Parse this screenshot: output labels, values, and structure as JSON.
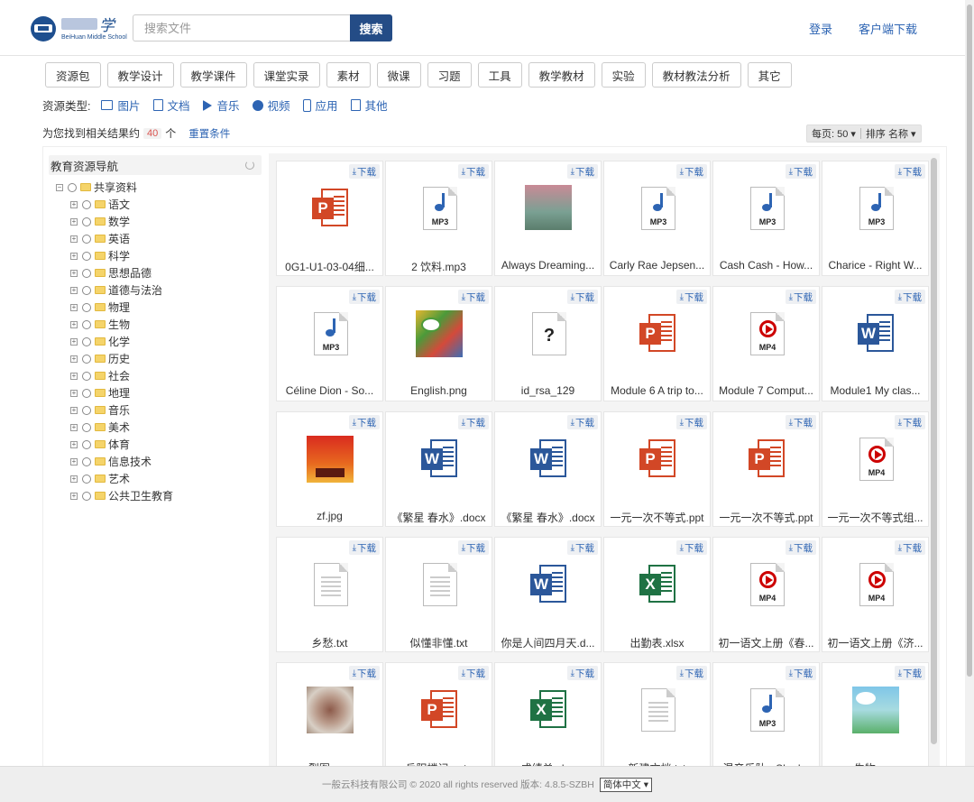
{
  "header": {
    "logo_name": "学",
    "logo_sub": "BeiHuan Middle School",
    "search_placeholder": "搜索文件",
    "search_button": "搜索",
    "login": "登录",
    "client_download": "客户端下载"
  },
  "categories": [
    "资源包",
    "教学设计",
    "教学课件",
    "课堂实录",
    "素材",
    "微课",
    "习题",
    "工具",
    "教学教材",
    "实验",
    "教材教法分析",
    "其它"
  ],
  "resource_types": {
    "label": "资源类型:",
    "items": [
      {
        "label": "图片",
        "icon": "image-icon"
      },
      {
        "label": "文档",
        "icon": "document-icon"
      },
      {
        "label": "音乐",
        "icon": "music-icon"
      },
      {
        "label": "视频",
        "icon": "video-icon"
      },
      {
        "label": "应用",
        "icon": "app-icon"
      },
      {
        "label": "其他",
        "icon": "other-icon"
      }
    ]
  },
  "results": {
    "prefix": "为您找到相关结果约",
    "count": "40",
    "suffix": "个",
    "reset": "重置条件",
    "per_page": "每页: 50 ▾",
    "sort": "排序 名称 ▾"
  },
  "nav": {
    "title": "教育资源导航",
    "root": "共享资料",
    "children": [
      "语文",
      "数学",
      "英语",
      "科学",
      "思想品德",
      "道德与法治",
      "物理",
      "生物",
      "化学",
      "历史",
      "社会",
      "地理",
      "音乐",
      "美术",
      "体育",
      "信息技术",
      "艺术",
      "公共卫生教育"
    ]
  },
  "download_label": "下载",
  "files": [
    {
      "name": "0G1-U1-03-04细...",
      "type": "ppt"
    },
    {
      "name": "2 饮料.mp3",
      "type": "mp3"
    },
    {
      "name": "Always Dreaming...",
      "type": "img1"
    },
    {
      "name": "Carly Rae Jepsen...",
      "type": "mp3"
    },
    {
      "name": "Cash Cash - How...",
      "type": "mp3"
    },
    {
      "name": "Charice - Right W...",
      "type": "mp3"
    },
    {
      "name": "Céline Dion - So...",
      "type": "mp3"
    },
    {
      "name": "English.png",
      "type": "img2"
    },
    {
      "name": "id_rsa_129",
      "type": "unknown"
    },
    {
      "name": "Module 6 A trip to...",
      "type": "ppt"
    },
    {
      "name": "Module 7 Comput...",
      "type": "mp4"
    },
    {
      "name": "Module1 My clas...",
      "type": "word"
    },
    {
      "name": "zf.jpg",
      "type": "img3"
    },
    {
      "name": "《繁星 春水》.docx",
      "type": "word"
    },
    {
      "name": "《繁星 春水》.docx",
      "type": "word"
    },
    {
      "name": "一元一次不等式.ppt",
      "type": "ppt"
    },
    {
      "name": "一元一次不等式.ppt",
      "type": "ppt"
    },
    {
      "name": "一元一次不等式组...",
      "type": "mp4"
    },
    {
      "name": "乡愁.txt",
      "type": "txt"
    },
    {
      "name": "似懂非懂.txt",
      "type": "txt"
    },
    {
      "name": "你是人间四月天.d...",
      "type": "word"
    },
    {
      "name": "出勤表.xlsx",
      "type": "xls"
    },
    {
      "name": "初一语文上册《春...",
      "type": "mp4"
    },
    {
      "name": "初一语文上册《济...",
      "type": "mp4"
    },
    {
      "name": "裂图.png",
      "type": "img4"
    },
    {
      "name": "岳阳楼记.pptx",
      "type": "ppt"
    },
    {
      "name": "成绩单.xlsx",
      "type": "xls"
    },
    {
      "name": "新建文档.txt",
      "type": "txt"
    },
    {
      "name": "混音乐队 - Sha l...",
      "type": "mp3"
    },
    {
      "name": "生物.png",
      "type": "img5"
    }
  ],
  "footer": {
    "text": "一般云科技有限公司 © 2020 all rights reserved 版本: 4.8.5-SZBH",
    "language": "简体中文 ▾"
  },
  "colors": {
    "accent": "#244c86",
    "link": "#2d64b3",
    "ppt": "#d24726",
    "word": "#2b579a",
    "excel": "#1f7244",
    "video": "#cc0000"
  }
}
